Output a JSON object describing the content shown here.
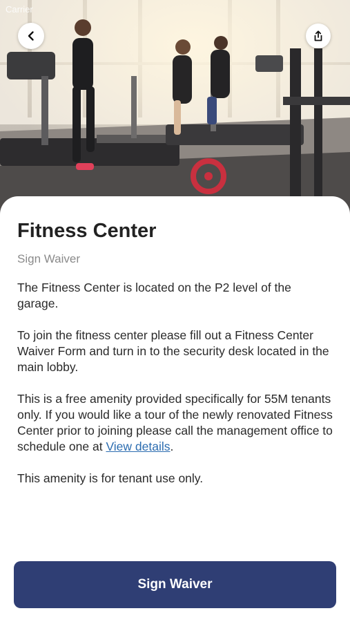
{
  "status_bar": {
    "carrier": "Carrier"
  },
  "header": {
    "back_icon": "chevron-left-icon",
    "share_icon": "share-icon"
  },
  "hero_image": {
    "description_icon": "gym-photo"
  },
  "content": {
    "title": "Fitness Center",
    "subtitle": "Sign Waiver",
    "paragraphs": [
      "The Fitness Center is located on the P2 level of the garage.",
      "To join the fitness center please fill out a Fitness Center Waiver Form and turn in to the security desk located in the main lobby.",
      "This is a free amenity provided specifically for 55M tenants only. If you would like a tour of the newly renovated Fitness Center prior to joining please call the management office to schedule one at ",
      "This amenity is for tenant use only."
    ],
    "link_text": "View details",
    "link_suffix": "."
  },
  "footer": {
    "button_label": "Sign Waiver"
  },
  "colors": {
    "button_bg": "#2f3e74",
    "link": "#2b6cb0",
    "title": "#222222",
    "subtitle": "#8a8a8a"
  }
}
